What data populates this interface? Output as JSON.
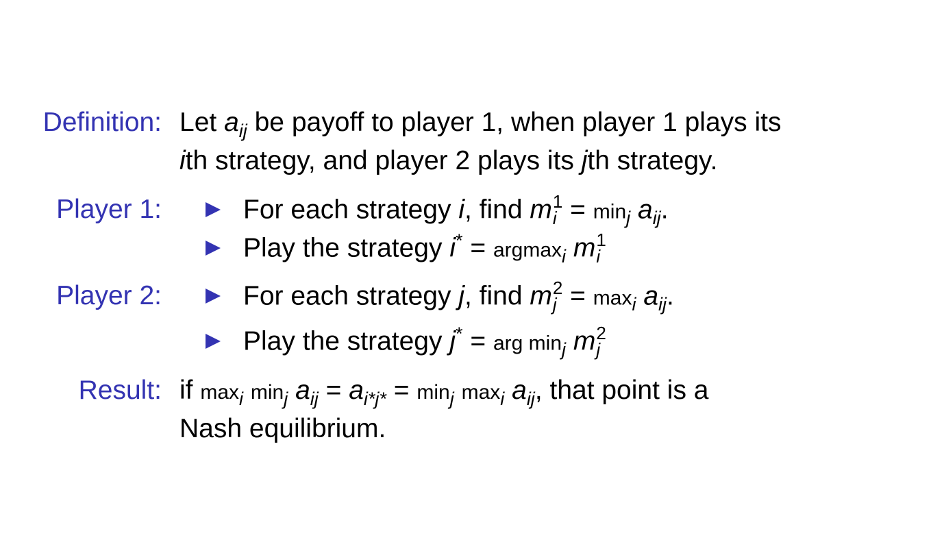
{
  "labels": {
    "definition": "Definition:",
    "player1": "Player 1:",
    "player2": "Player 2:",
    "result": "Result:"
  },
  "colors": {
    "label": "#3333b2",
    "bullet": "#3333b2"
  },
  "bullet_icon": "triangle-right",
  "lines": [
    {
      "segments": [
        {
          "k": "n",
          "t": "Let "
        },
        {
          "k": "i",
          "t": "a"
        },
        {
          "k": "sub",
          "t": "ij"
        },
        {
          "k": "n",
          "t": " be payoff to player 1, when player 1 plays its"
        }
      ]
    },
    {
      "segments": [
        {
          "k": "i",
          "t": "i"
        },
        {
          "k": "n",
          "t": "th strategy, and player 2 plays its "
        },
        {
          "k": "i",
          "t": "j"
        },
        {
          "k": "n",
          "t": "th strategy."
        }
      ]
    },
    {
      "segments": [
        {
          "k": "n",
          "t": "For each strategy "
        },
        {
          "k": "i",
          "t": "i"
        },
        {
          "k": "n",
          "t": ", find "
        },
        {
          "k": "i",
          "t": "m"
        },
        {
          "k": "ss",
          "sup": "1",
          "sub": "i"
        },
        {
          "k": "n",
          "t": " = "
        },
        {
          "k": "m",
          "t": "min"
        },
        {
          "k": "sub",
          "t": "j"
        },
        {
          "k": "n",
          "t": " "
        },
        {
          "k": "i",
          "t": "a"
        },
        {
          "k": "sub",
          "t": "ij"
        },
        {
          "k": "n",
          "t": "."
        }
      ]
    },
    {
      "segments": [
        {
          "k": "n",
          "t": "Play the strategy "
        },
        {
          "k": "i",
          "t": "i"
        },
        {
          "k": "sup",
          "t": "*"
        },
        {
          "k": "n",
          "t": " = "
        },
        {
          "k": "m",
          "t": "argmax"
        },
        {
          "k": "sub",
          "t": "i"
        },
        {
          "k": "n",
          "t": " "
        },
        {
          "k": "i",
          "t": "m"
        },
        {
          "k": "ss",
          "sup": "1",
          "sub": "i"
        }
      ]
    },
    {
      "segments": [
        {
          "k": "n",
          "t": "For each strategy "
        },
        {
          "k": "i",
          "t": "j"
        },
        {
          "k": "n",
          "t": ", find "
        },
        {
          "k": "i",
          "t": "m"
        },
        {
          "k": "ss",
          "sup": "2",
          "sub": "j"
        },
        {
          "k": "n",
          "t": " = "
        },
        {
          "k": "m",
          "t": "max"
        },
        {
          "k": "sub",
          "t": "i"
        },
        {
          "k": "n",
          "t": " "
        },
        {
          "k": "i",
          "t": "a"
        },
        {
          "k": "sub",
          "t": "ij"
        },
        {
          "k": "n",
          "t": "."
        }
      ]
    },
    {
      "segments": [
        {
          "k": "n",
          "t": "Play the strategy "
        },
        {
          "k": "i",
          "t": "j"
        },
        {
          "k": "sup",
          "t": "*"
        },
        {
          "k": "n",
          "t": " = "
        },
        {
          "k": "m",
          "t": "arg min"
        },
        {
          "k": "sub",
          "t": "j"
        },
        {
          "k": "n",
          "t": " "
        },
        {
          "k": "i",
          "t": "m"
        },
        {
          "k": "ss",
          "sup": "2",
          "sub": "j"
        }
      ]
    },
    {
      "segments": [
        {
          "k": "n",
          "t": "if "
        },
        {
          "k": "m",
          "t": "max"
        },
        {
          "k": "sub",
          "t": "i"
        },
        {
          "k": "n",
          "t": " "
        },
        {
          "k": "m",
          "t": "min"
        },
        {
          "k": "sub",
          "t": "j"
        },
        {
          "k": "n",
          "t": " "
        },
        {
          "k": "i",
          "t": "a"
        },
        {
          "k": "sub",
          "t": "ij"
        },
        {
          "k": "n",
          "t": " = "
        },
        {
          "k": "i",
          "t": "a"
        },
        {
          "k": "sub",
          "t": "i*j*"
        },
        {
          "k": "n",
          "t": " = "
        },
        {
          "k": "m",
          "t": "min"
        },
        {
          "k": "sub",
          "t": "j"
        },
        {
          "k": "n",
          "t": " "
        },
        {
          "k": "m",
          "t": "max"
        },
        {
          "k": "sub",
          "t": "i"
        },
        {
          "k": "n",
          "t": " "
        },
        {
          "k": "i",
          "t": "a"
        },
        {
          "k": "sub",
          "t": "ij"
        },
        {
          "k": "n",
          "t": ", that point is a"
        }
      ]
    },
    {
      "segments": [
        {
          "k": "n",
          "t": "Nash equilibrium."
        }
      ]
    }
  ]
}
